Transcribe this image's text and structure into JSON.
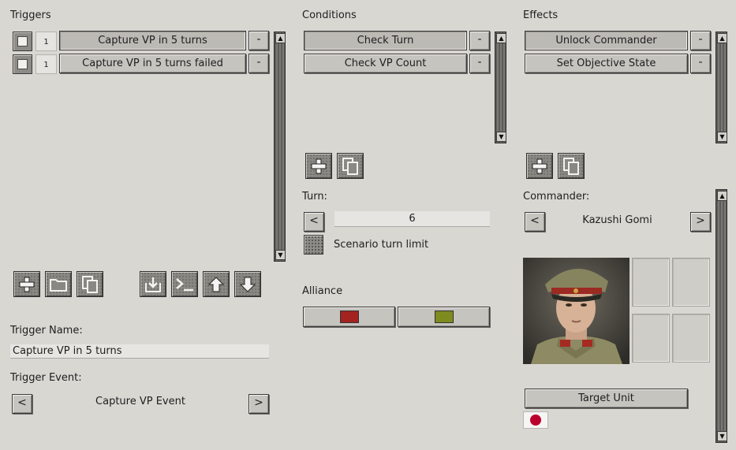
{
  "triggers": {
    "header": "Triggers",
    "items": [
      {
        "num": "1",
        "label": "Capture VP in 5 turns",
        "remove": "-"
      },
      {
        "num": "1",
        "label": "Capture VP in 5 turns failed",
        "remove": "-"
      }
    ],
    "toolbar_icons": [
      "add-icon",
      "folder-icon",
      "copy-icon",
      "import-icon",
      "console-icon",
      "arrow-up-icon",
      "arrow-down-icon"
    ],
    "name_label": "Trigger Name:",
    "name_value": "Capture VP in 5 turns",
    "event_label": "Trigger Event:",
    "event_value": "Capture VP Event",
    "prev": "<",
    "next": ">"
  },
  "conditions": {
    "header": "Conditions",
    "items": [
      {
        "label": "Check Turn",
        "remove": "-"
      },
      {
        "label": "Check VP Count",
        "remove": "-"
      }
    ],
    "turn_label": "Turn:",
    "turn_value": "6",
    "prev": "<",
    "scenario_limit_label": "Scenario turn limit",
    "alliance_label": "Alliance",
    "alliance_colors": [
      "#a3231f",
      "#7e8b1f"
    ]
  },
  "effects": {
    "header": "Effects",
    "items": [
      {
        "label": "Unlock Commander",
        "remove": "-"
      },
      {
        "label": "Set Objective State",
        "remove": "-"
      }
    ],
    "commander_label": "Commander:",
    "commander_name": "Kazushi Gomi",
    "prev": "<",
    "next": ">",
    "target_unit_label": "Target Unit",
    "flag": "japan-flag-icon"
  },
  "colors": {
    "background": "#d9d7d2",
    "button": "#c6c4bf",
    "flag_red": "#bc002d"
  }
}
